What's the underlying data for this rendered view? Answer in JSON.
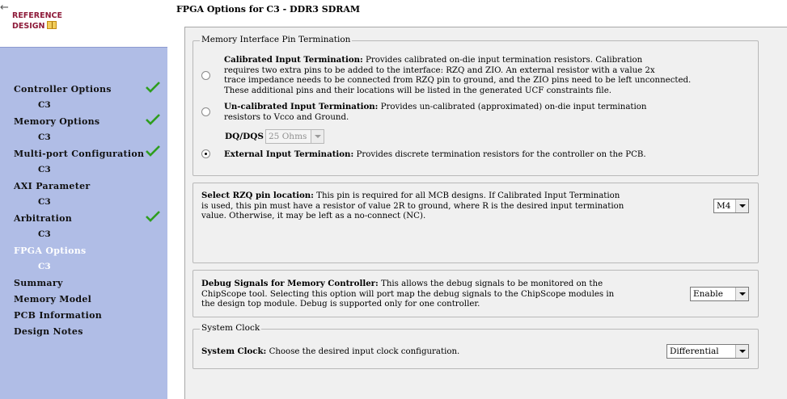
{
  "sidebar": {
    "back_arrow": "←",
    "logo_line1": "REFERENCE",
    "logo_line2": "DESIGN",
    "items": [
      {
        "label": "Controller Options",
        "sub": "C3",
        "checked": true
      },
      {
        "label": "Memory Options",
        "sub": "C3",
        "checked": true
      },
      {
        "label": "Multi-port Configuration",
        "sub": "C3",
        "checked": true
      },
      {
        "label": "AXI Parameter",
        "sub": "C3",
        "checked": false
      },
      {
        "label": "Arbitration",
        "sub": "C3",
        "checked": true
      },
      {
        "label": "FPGA Options",
        "sub": "C3",
        "checked": false,
        "active": true
      },
      {
        "label": "Summary"
      },
      {
        "label": "Memory Model"
      },
      {
        "label": "PCB Information"
      },
      {
        "label": "Design Notes"
      }
    ],
    "colors": {
      "background": "#b0bde6",
      "active_text": "#ffffff",
      "check": "#2e9e1e"
    }
  },
  "page": {
    "title": "FPGA Options for C3 - DDR3 SDRAM"
  },
  "termination": {
    "legend": "Memory Interface Pin Termination",
    "calibrated": {
      "title": "Calibrated Input Termination:",
      "line1": " Provides calibrated on-die input termination resistors. Calibration",
      "line2": "requires two extra pins to be added to the interface: RZQ and ZIO. An external resistor with a value 2x",
      "line3": "trace impedance needs to be connected from RZQ pin to ground, and the ZIO pins need to be left unconnected.",
      "line4": "These additional pins and their locations will be listed in the generated UCF constraints file.",
      "selected": false
    },
    "uncalibrated": {
      "title": "Un-calibrated Input Termination:",
      "line1": " Provides un-calibrated (approximated) on-die input termination",
      "line2": "resistors to Vcco and Ground.",
      "selected": false
    },
    "dqdqs_label": "DQ/DQS",
    "dqdqs_value": "25 Ohms",
    "external": {
      "title": "External Input Termination:",
      "text": " Provides discrete termination resistors for the controller on the PCB.",
      "selected": true
    }
  },
  "rzq": {
    "title": "Select RZQ pin location:",
    "line1": " This pin is required for all MCB designs. If Calibrated Input Termination",
    "line2": "is used, this pin must have a resistor of value 2R to ground, where R is the desired input termination",
    "line3": "value. Otherwise, it may be left as a no-connect (NC).",
    "value": "M4"
  },
  "debug": {
    "title": "Debug Signals for Memory Controller:",
    "line1": " This allows the debug signals to be monitored on the",
    "line2": "ChipScope tool. Selecting this option will port map the debug signals to the ChipScope modules in",
    "line3": "the design top module. Debug is supported only for one controller.",
    "value": "Enable"
  },
  "clock": {
    "legend": "System Clock",
    "title": "System Clock:",
    "text": " Choose the desired input clock configuration.",
    "value": "Differential"
  }
}
